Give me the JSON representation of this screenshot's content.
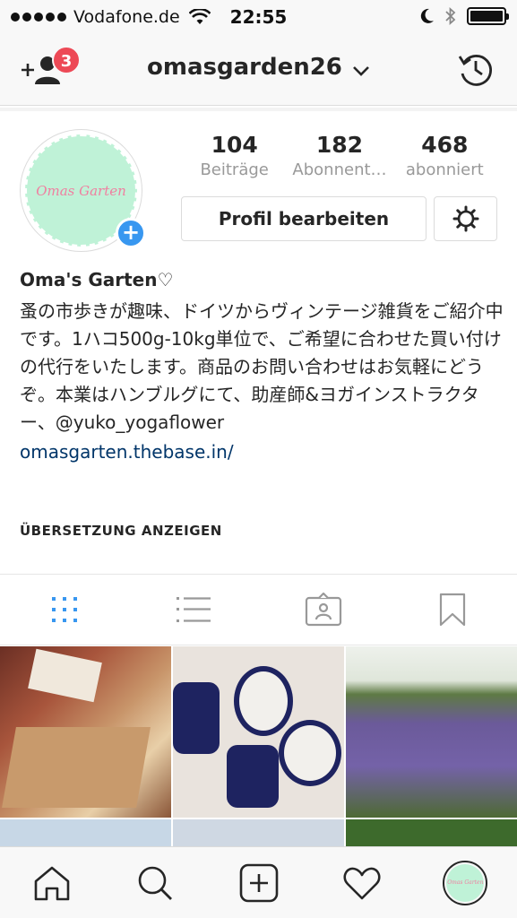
{
  "status_bar": {
    "carrier": "Vodafone.de",
    "time": "22:55",
    "icons": [
      "signal-dots",
      "wifi-icon",
      "moon-icon",
      "bluetooth-icon",
      "battery-icon"
    ]
  },
  "header": {
    "username": "omasgarden26",
    "notification_count": "3",
    "left_icon": "add-person-icon",
    "right_icon": "history-icon"
  },
  "profile": {
    "avatar_text": "Omas Garten",
    "stats": [
      {
        "number": "104",
        "label": "Beiträge"
      },
      {
        "number": "182",
        "label": "Abonnent…"
      },
      {
        "number": "468",
        "label": "abonniert"
      }
    ],
    "edit_button": "Profil bearbeiten",
    "display_name": "Oma's Garten♡",
    "bio": "蚤の市歩きが趣味、ドイツからヴィンテージ雑貨をご紹介中です。1ハコ500g-10kg単位で、ご希望に合わせた買い付けの代行をいたします。商品のお問い合わせはお気軽にどうぞ。本業はハンブルグにて、助産師&ヨガインストラクター、@yuko_yogaflower",
    "website": "omasgarten.thebase.in/",
    "translate_label": "ÜBERSETZUNG ANZEIGEN"
  },
  "tabs": {
    "items": [
      "grid-icon",
      "list-icon",
      "tagged-icon",
      "saved-icon"
    ],
    "active": "grid-icon",
    "active_color": "#3897f0"
  },
  "bottom_nav": {
    "items": [
      "home-icon",
      "search-icon",
      "new-post-icon",
      "activity-icon",
      "profile-avatar"
    ]
  },
  "colors": {
    "badge": "#ed4956",
    "accent": "#3897f0",
    "link": "#003569",
    "avatar_bg": "#bff2d7",
    "avatar_text": "#f07fa0"
  }
}
